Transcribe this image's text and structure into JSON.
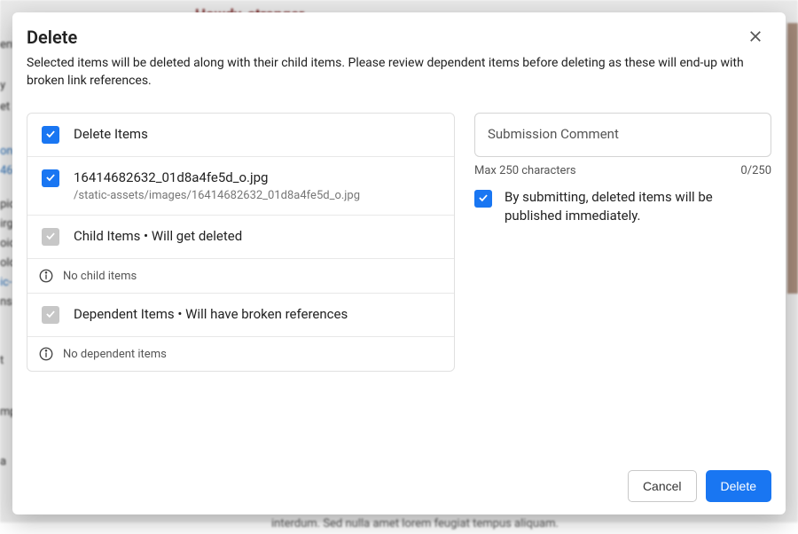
{
  "modal": {
    "title": "Delete",
    "subtitle": "Selected items will be deleted along with their child items. Please review dependent items before deleting as these will end-up with broken link references."
  },
  "left": {
    "deleteItemsLabel": "Delete Items",
    "item": {
      "name": "16414682632_01d8a4fe5d_o.jpg",
      "path": "/static-assets/images/16414682632_01d8a4fe5d_o.jpg"
    },
    "childHeader": "Child Items •  Will get deleted",
    "noChild": "No child items",
    "depHeader": "Dependent Items •  Will have broken references",
    "noDep": "No dependent items"
  },
  "right": {
    "commentPlaceholder": "Submission Comment",
    "maxLabel": "Max 250 characters",
    "counter": "0/250",
    "publishNote": "By submitting, deleted items will be published immediately."
  },
  "footer": {
    "cancel": "Cancel",
    "delete": "Delete"
  },
  "colors": {
    "primary": "#1976f2"
  }
}
